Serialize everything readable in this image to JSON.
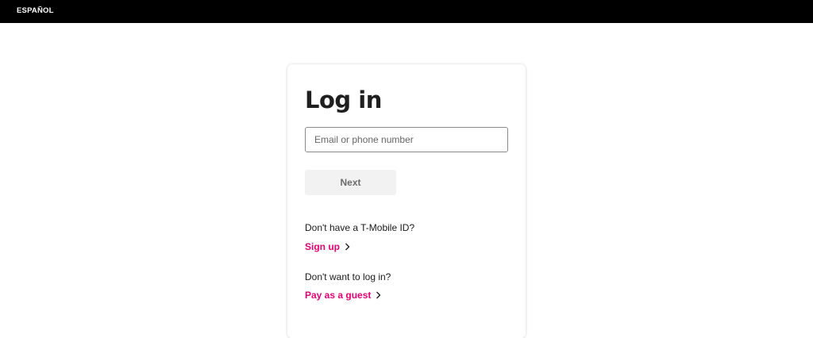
{
  "header": {
    "language_link": "ESPAÑOL"
  },
  "login": {
    "title": "Log in",
    "identifier_placeholder": "Email or phone number",
    "identifier_value": "",
    "next_label": "Next"
  },
  "signup": {
    "prompt": "Don't have a T-Mobile ID?",
    "link_label": "Sign up"
  },
  "guest": {
    "prompt": "Don't want to log in?",
    "link_label": "Pay as a guest"
  },
  "colors": {
    "accent": "#e20074",
    "topbar": "#000000"
  },
  "icons": {
    "link_arrow": "chevron-right-icon"
  }
}
